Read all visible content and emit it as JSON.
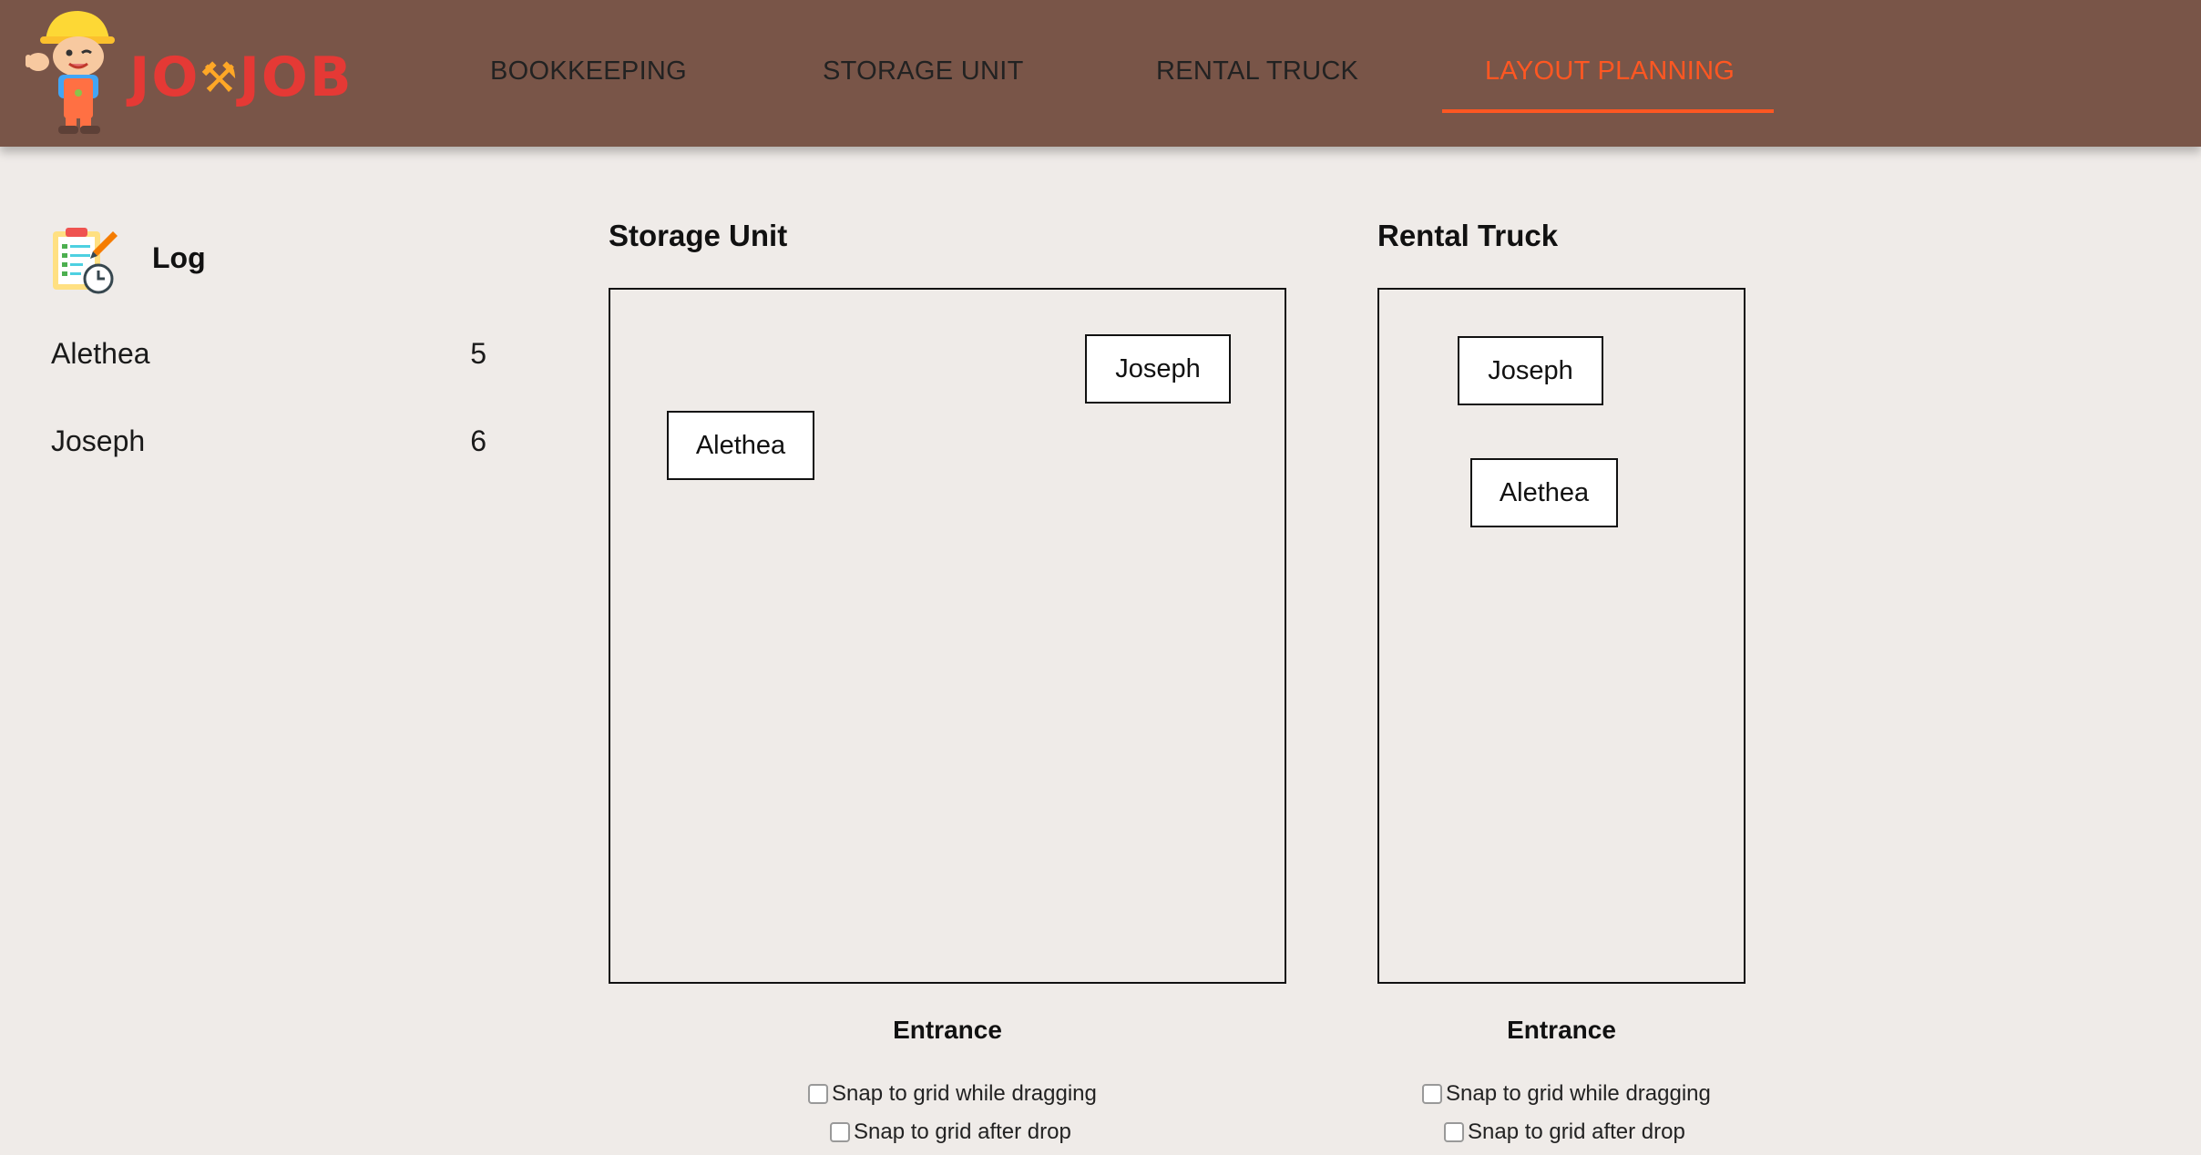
{
  "brand": {
    "logo_text_left": "JO",
    "logo_text_right": "JOB",
    "logo_glyph": "⚒"
  },
  "nav": {
    "items": [
      {
        "label": "BOOKKEEPING"
      },
      {
        "label": "STORAGE UNIT"
      },
      {
        "label": "RENTAL TRUCK"
      },
      {
        "label": "LAYOUT PLANNING"
      }
    ],
    "active_index": 3
  },
  "log": {
    "title": "Log",
    "entries": [
      {
        "name": "Alethea",
        "count": "5"
      },
      {
        "name": "Joseph",
        "count": "6"
      }
    ]
  },
  "storage_unit": {
    "title": "Storage Unit",
    "boxes": {
      "joseph": "Joseph",
      "alethea": "Alethea"
    },
    "entrance": "Entrance",
    "snap_while_dragging": "Snap to grid while dragging",
    "snap_after_drop": "Snap to grid after drop"
  },
  "rental_truck": {
    "title": "Rental Truck",
    "boxes": {
      "joseph": "Joseph",
      "alethea": "Alethea"
    },
    "entrance": "Entrance",
    "snap_while_dragging": "Snap to grid while dragging",
    "snap_after_drop": "Snap to grid after drop"
  },
  "colors": {
    "header_bg": "#795548",
    "accent": "#ff5722",
    "page_bg": "#efebe8",
    "logo_red": "#e53935"
  }
}
